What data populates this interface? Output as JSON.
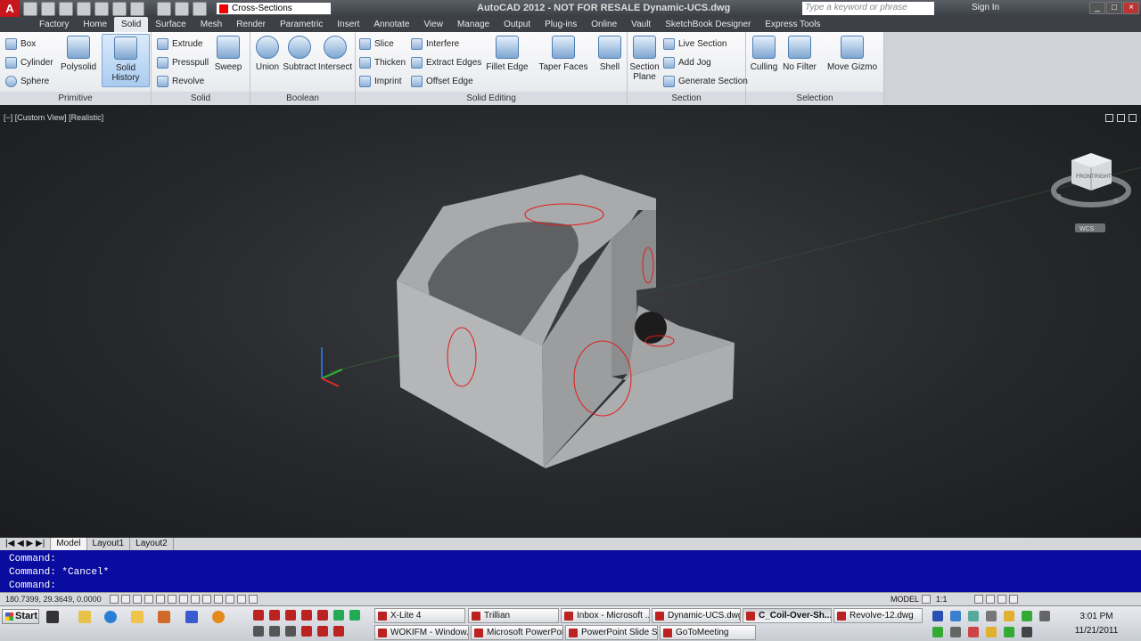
{
  "window": {
    "logo": "A",
    "workspace": "Cross-Sections",
    "title": "AutoCAD 2012 - NOT FOR RESALE   Dynamic-UCS.dwg",
    "search_placeholder": "Type a keyword or phrase",
    "signin": "Sign In"
  },
  "tabs": [
    "Factory",
    "Home",
    "Solid",
    "Surface",
    "Mesh",
    "Render",
    "Parametric",
    "Insert",
    "Annotate",
    "View",
    "Manage",
    "Output",
    "Plug-ins",
    "Online",
    "Vault",
    "SketchBook Designer",
    "Express Tools"
  ],
  "active_tab": "Solid",
  "ribbon": {
    "primitive": {
      "title": "Primitive",
      "box": "Box",
      "cylinder": "Cylinder",
      "sphere": "Sphere",
      "polysolid": "Polysolid",
      "solid_history": "Solid History"
    },
    "solid": {
      "title": "Solid",
      "extrude": "Extrude",
      "presspull": "Presspull",
      "revolve": "Revolve",
      "sweep": "Sweep"
    },
    "boolean": {
      "title": "Boolean",
      "union": "Union",
      "subtract": "Subtract",
      "intersect": "Intersect"
    },
    "solid_editing": {
      "title": "Solid Editing",
      "slice": "Slice",
      "thicken": "Thicken",
      "imprint": "Imprint",
      "interfere": "Interfere",
      "extract_edges": "Extract Edges",
      "offset_edge": "Offset Edge",
      "fillet_edge": "Fillet Edge",
      "taper_faces": "Taper Faces",
      "shell": "Shell"
    },
    "section": {
      "title": "Section",
      "section_plane_1": "Section",
      "section_plane_2": "Plane",
      "live_section": "Live Section",
      "add_jog": "Add Jog",
      "generate_section": "Generate Section"
    },
    "selection": {
      "title": "Selection",
      "culling": "Culling",
      "no_filter": "No Filter",
      "move_gizmo": "Move Gizmo"
    }
  },
  "viewport": {
    "label": "[−] [Custom View] [Realistic]",
    "viewcube_front": "FRONT",
    "viewcube_right": "RIGHT",
    "wcs": "WCS",
    "compass_s": "S",
    "compass_e": "E"
  },
  "layout_tabs": [
    "Model",
    "Layout1",
    "Layout2"
  ],
  "command_lines": [
    "Command:",
    "Command: *Cancel*",
    "Command:"
  ],
  "status": {
    "coords": "180.7399, 29.3649, 0.0000",
    "model": "MODEL",
    "scale": "1:1"
  },
  "taskbar": {
    "start": "Start",
    "row1": [
      "X-Lite 4",
      "Trillian",
      "Inbox - Microsoft ...",
      "Dynamic-UCS.dwg",
      "C_Coil-Over-Sh...",
      "Revolve-12.dwg"
    ],
    "row2": [
      "WOKIFM - Window...",
      "Microsoft PowerPoi...",
      "PowerPoint Slide S...",
      "GoToMeeting"
    ],
    "active": "C_Coil-Over-Sh...",
    "time": "3:01 PM",
    "date": "11/21/2011"
  }
}
